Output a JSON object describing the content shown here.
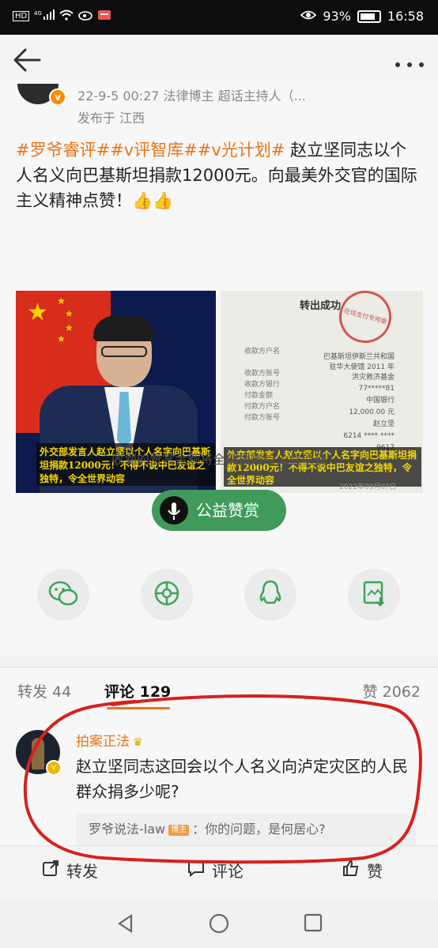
{
  "status_bar": {
    "network_left": [
      "HD",
      "4G",
      "signal",
      "wifi",
      "weibo",
      "mail"
    ],
    "battery": "93%",
    "time": "16:58"
  },
  "post": {
    "date_line": "22-9-5 00:27  法律博主 超话主持人（...",
    "location_line": "发布于 江西",
    "hashtags": "#罗爷睿评##v评智库##v光计划#",
    "text": " 赵立坚同志以个人名义向巴基斯坦捐款12000元。向最美外交官的国际主义精神点赞！",
    "emoji": "👍👍",
    "image_left_caption": "外交部发言人赵立坚以个人名字向巴基斯坦捐款12000元！不得不说中巴友谊之独特，令全世界动容",
    "image_right_title": "转出成功",
    "image_right_stamp": "在线支付专用章",
    "image_right_fields": [
      "收款方户名",
      "收款方账号",
      "收款方银行",
      "付款金额",
      "付款方户名",
      "付款方账号"
    ],
    "image_right_values": [
      "巴基斯坦伊斯兰共和国驻华大使馆 2011 年洪灾救济基金",
      "77*****81",
      "中国银行",
      "12,000.00 元",
      "赵立坚",
      "6214 **** **** 9617"
    ],
    "image_right_caption": "外交部发言人赵立坚以个人名字向巴基斯坦捐款12000元！不得不说中巴友谊之独特，令全世界动容",
    "image_right_date": "2022年09月0?日"
  },
  "reward": {
    "note": "收到的赞赏金额将全部捐赠给公益项目",
    "button_label": "公益赞赏"
  },
  "share_icons": [
    "wechat-icon",
    "moments-icon",
    "qq-icon",
    "save-image-icon"
  ],
  "tabs": {
    "repost": "转发 44",
    "comments": "评论 129",
    "likes": "赞 2062"
  },
  "comment": {
    "author": "拍案正法",
    "text": "赵立坚同志这回会以个人名义向泸定灾区的人民群众捐多少呢?",
    "reply_author": "罗爷说法-law",
    "reply_tag": "博主",
    "reply_text": "：你的问题，是何居心?"
  },
  "actions": {
    "repost": "转发",
    "comment": "评论",
    "like": "赞"
  },
  "colors": {
    "accent_orange": "#e8761c",
    "reward_green": "#3f9a5b",
    "annotation_red": "#d8201f"
  }
}
